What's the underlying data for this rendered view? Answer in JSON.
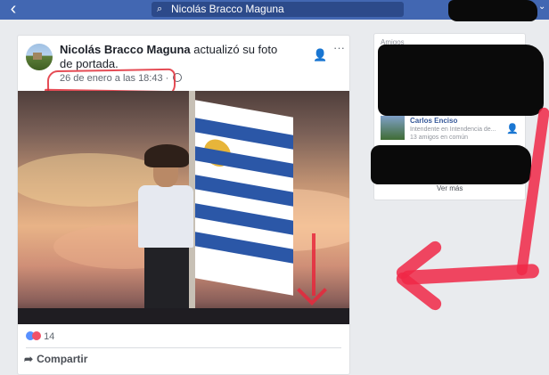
{
  "search": {
    "query": "Nicolás Bracco Maguna",
    "icon": "search-icon"
  },
  "post": {
    "author": "Nicolás Bracco Maguna",
    "action": "actualizó su foto de portada.",
    "timestamp": "26 de enero a las 18:43",
    "separator": "·",
    "reaction_count": "14",
    "share_label": "Compartir"
  },
  "sidebar": {
    "title": "Amigos",
    "friend": {
      "name": "Carlos Enciso",
      "subtitle": "Intendente en Intendencia de...",
      "mutual": "13 amigos en común"
    },
    "see_more": "Ver más"
  },
  "colors": {
    "topbar": "#4267b2",
    "annotation": "#e8283c"
  }
}
